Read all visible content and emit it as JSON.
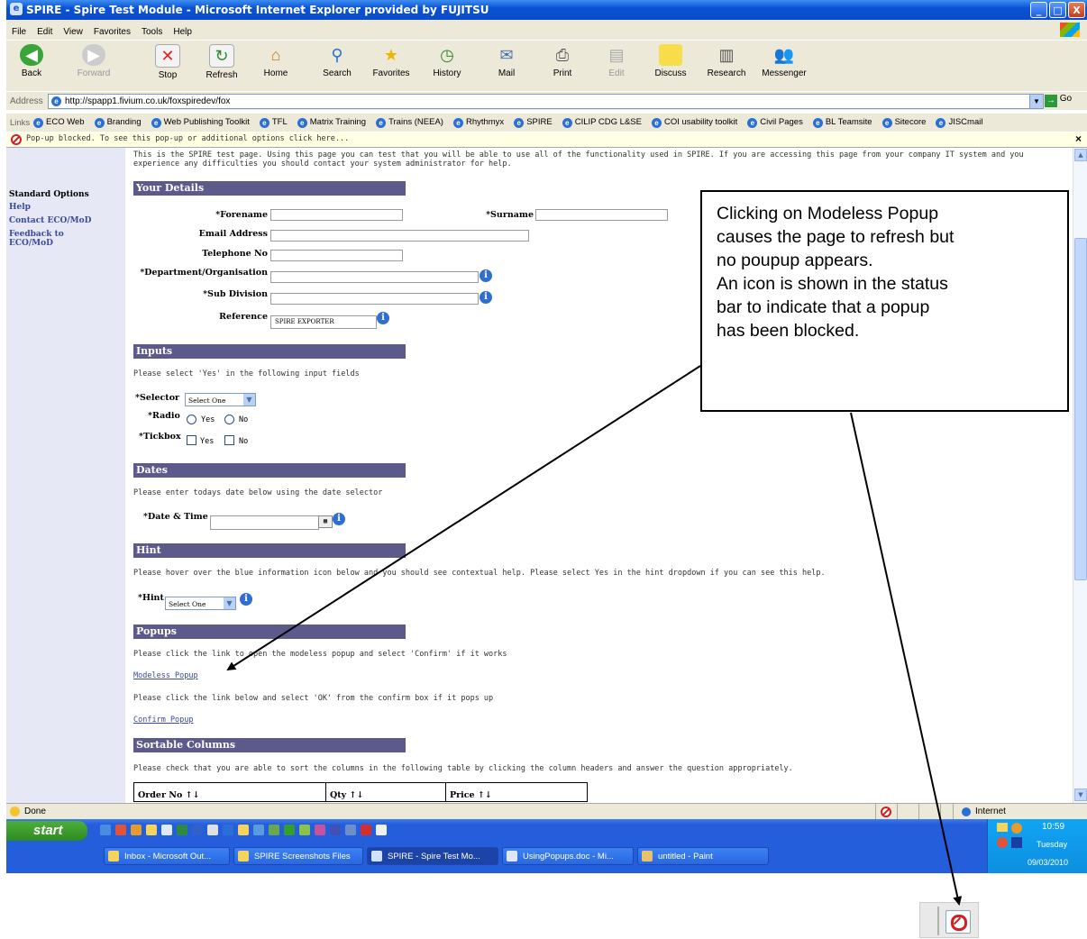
{
  "window": {
    "title": "SPIRE - Spire Test Module - Microsoft Internet Explorer provided by FUJITSU",
    "controls": [
      "_",
      "□",
      "X"
    ]
  },
  "menu": [
    "File",
    "Edit",
    "View",
    "Favorites",
    "Tools",
    "Help"
  ],
  "toolbar": {
    "back": "Back",
    "forward": "Forward",
    "stop": "Stop",
    "refresh": "Refresh",
    "home": "Home",
    "search": "Search",
    "favorites": "Favorites",
    "history": "History",
    "mail": "Mail",
    "print": "Print",
    "edit": "Edit",
    "discuss": "Discuss",
    "research": "Research",
    "messenger": "Messenger"
  },
  "address": {
    "label": "Address",
    "url": "http://spapp1.fivium.co.uk/foxspiredev/fox",
    "go": "Go"
  },
  "links": {
    "label": "Links",
    "items": [
      "ECO Web",
      "Branding",
      "Web Publishing Toolkit",
      "TFL",
      "Matrix Training",
      "Trains (NEEA)",
      "Rhythmyx",
      "SPIRE",
      "CILIP CDG L&SE",
      "COI usability toolkit",
      "Civil Pages",
      "BL Teamsite",
      "Sitecore",
      "JISCmail"
    ]
  },
  "infobar": {
    "text": "Pop-up blocked. To see this pop-up or additional options click here...",
    "close": "×"
  },
  "sidebar": {
    "heading": "Standard Options",
    "items": [
      "Help",
      "Contact ECO/MoD",
      "Feedback to",
      "ECO/MoD"
    ]
  },
  "page": {
    "intro1": "This is the SPIRE test page. Using this page you can test that you will be able to use all of the functionality used in SPIRE. If you are accessing this page from your company IT system and you",
    "intro2": "experience any difficulties you should contact your system administrator for help.",
    "your_details": {
      "heading": "Your Details",
      "forename": "*Forename",
      "surname": "*Surname",
      "email": "Email Address",
      "telephone": "Telephone No",
      "department": "*Department/Organisation",
      "subdivision": "*Sub Division",
      "reference": "Reference",
      "reference_value": "SPIRE EXPORTER"
    },
    "inputs": {
      "heading": "Inputs",
      "instruction": "Please select 'Yes' in the following input fields",
      "selector": "*Selector",
      "selector_value": "Select One",
      "radio": "*Radio",
      "tickbox": "*Tickbox",
      "yes": "Yes",
      "no": "No"
    },
    "dates": {
      "heading": "Dates",
      "instruction": "Please enter todays date below using the date selector",
      "date_time": "*Date & Time"
    },
    "hint": {
      "heading": "Hint",
      "instruction": "Please hover over the blue information icon below and you should see contextual help. Please select Yes in the hint dropdown if you can see this help.",
      "label": "*Hint",
      "value": "Select One"
    },
    "popups": {
      "heading": "Popups",
      "instruction1": "Please click the link to open the modeless popup and select 'Confirm' if it works",
      "modeless_link": "Modeless Popup",
      "instruction2": "Please click the link below and select 'OK' from the confirm box if it pops up",
      "confirm_link": "Confirm Popup"
    },
    "sortable": {
      "heading": "Sortable Columns",
      "instruction": "Please check that you are able to sort the columns in the following table by clicking the column headers and answer the question appropriately.",
      "columns": [
        "Order No ↑↓",
        "Qty ↑↓",
        "Price ↑↓"
      ]
    },
    "info_glyph": "i"
  },
  "status": {
    "text": "Done",
    "zone": "Internet"
  },
  "taskbar": {
    "start": "start",
    "tasks": [
      "Inbox - Microsoft Out...",
      "SPIRE Screenshots Files",
      "SPIRE - Spire Test Mo...",
      "UsingPopups.doc - Mi...",
      "untitled - Paint"
    ],
    "clock": "10:59",
    "day": "Tuesday",
    "date": "09/03/2010"
  },
  "callout": {
    "lines": [
      "Clicking on Modeless Popup",
      "causes the page to refresh but",
      "no poupup appears.",
      "An icon is shown in the status",
      "bar to indicate that a popup",
      "has been blocked."
    ]
  }
}
